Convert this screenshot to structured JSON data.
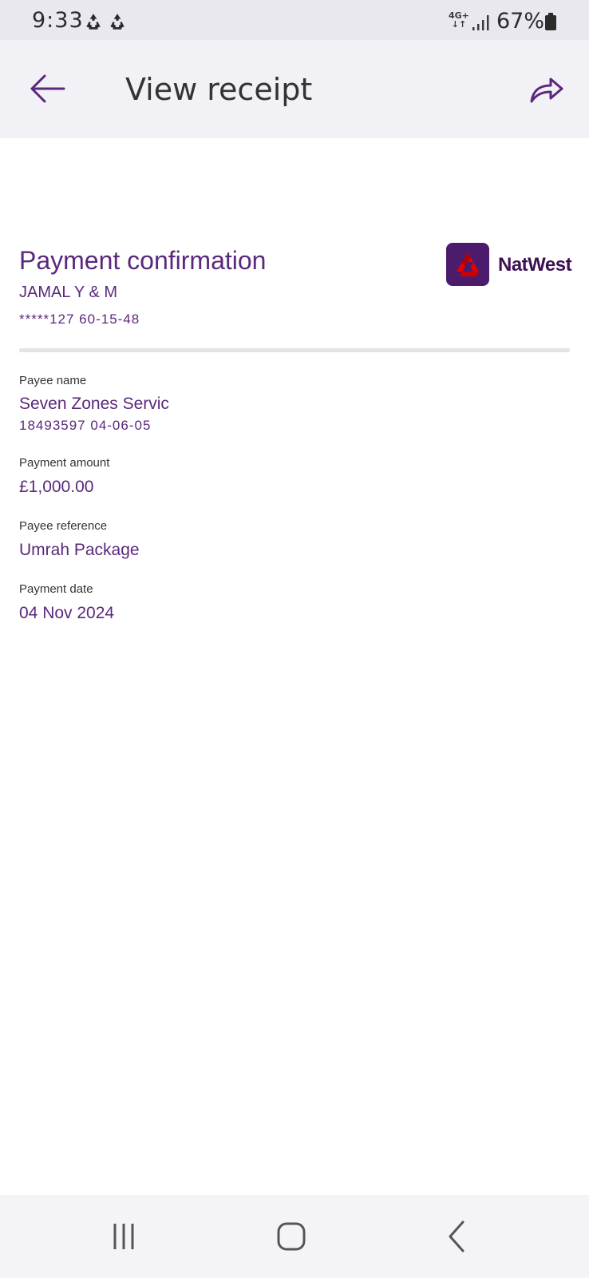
{
  "status_bar": {
    "time": "9:33",
    "network": "4G+",
    "network_arrows": "↓↑",
    "battery": "67%"
  },
  "app_bar": {
    "title": "View receipt",
    "back_icon": "arrow-left-icon",
    "share_icon": "share-icon"
  },
  "receipt": {
    "title": "Payment confirmation",
    "account_name": "JAMAL Y & M",
    "account_number": "*****127 60-15-48",
    "brand": "NatWest",
    "fields": [
      {
        "label": "Payee name",
        "value": "Seven Zones Servic",
        "sub": "18493597 04-06-05"
      },
      {
        "label": "Payment amount",
        "value": "£1,000.00"
      },
      {
        "label": "Payee reference",
        "value": "Umrah Package"
      },
      {
        "label": "Payment date",
        "value": "04 Nov 2024"
      }
    ]
  },
  "colors": {
    "accent": "#5a287d",
    "brand_dark": "#3c1053",
    "brand_red": "#e60000"
  }
}
